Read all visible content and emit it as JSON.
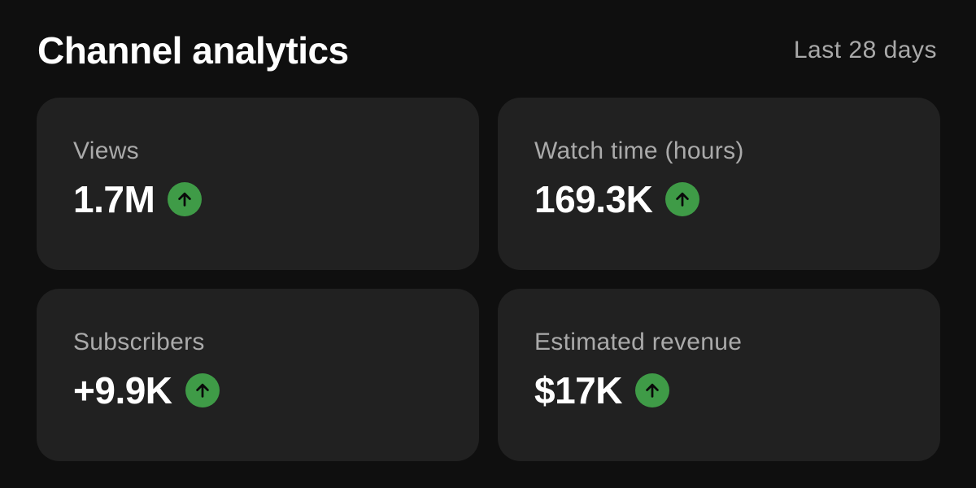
{
  "header": {
    "title": "Channel analytics",
    "period": "Last 28 days"
  },
  "cards": [
    {
      "label": "Views",
      "value": "1.7M",
      "trend": "up",
      "trend_icon": "arrow-up-icon"
    },
    {
      "label": "Watch time (hours)",
      "value": "169.3K",
      "trend": "up",
      "trend_icon": "arrow-up-icon"
    },
    {
      "label": "Subscribers",
      "value": "+9.9K",
      "trend": "up",
      "trend_icon": "arrow-up-icon"
    },
    {
      "label": "Estimated revenue",
      "value": "$17K",
      "trend": "up",
      "trend_icon": "arrow-up-icon"
    }
  ],
  "colors": {
    "background": "#0f0f0f",
    "card": "#212121",
    "trend_up": "#3f9b47",
    "label": "#aaaaaa",
    "value": "#ffffff"
  }
}
